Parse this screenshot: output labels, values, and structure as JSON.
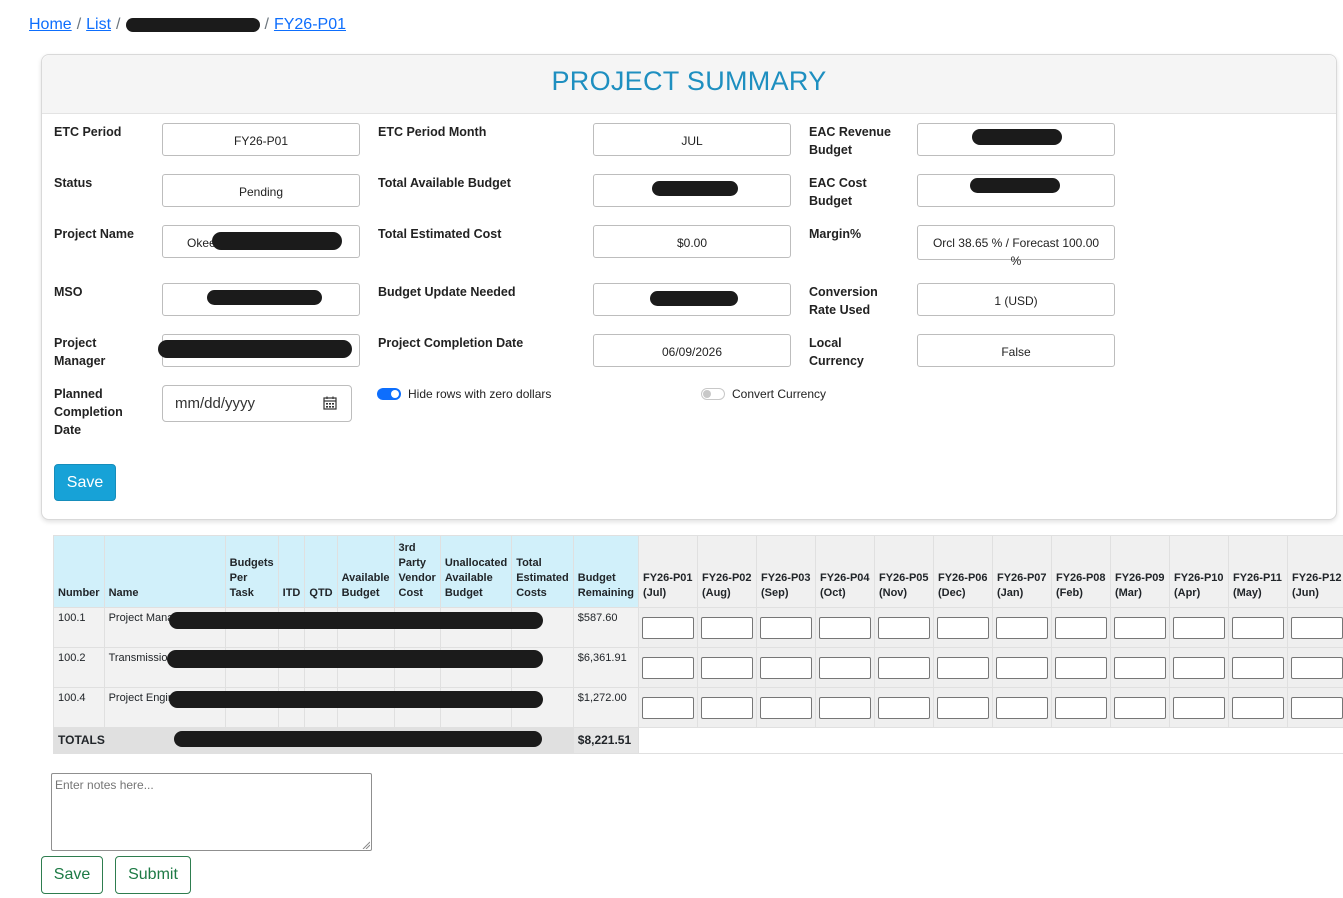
{
  "breadcrumb": {
    "home": "Home",
    "list": "List",
    "current": "FY26-P01",
    "separator": "/"
  },
  "summary": {
    "title": "PROJECT SUMMARY",
    "fields": {
      "etc_period": {
        "label": "ETC Period",
        "value": "FY26-P01"
      },
      "status": {
        "label": "Status",
        "value": "Pending"
      },
      "project_name": {
        "label": "Project Name",
        "value": "Okee"
      },
      "mso": {
        "label": "MSO",
        "value": ""
      },
      "project_manager": {
        "label": "Project Manager",
        "value": ""
      },
      "planned_completion_date": {
        "label": "Planned Completion Date",
        "placeholder": "mm/dd/yyyy"
      },
      "etc_period_month": {
        "label": "ETC Period Month",
        "value": "JUL"
      },
      "total_available_budget": {
        "label": "Total Available Budget",
        "value": ""
      },
      "total_estimated_cost": {
        "label": "Total Estimated Cost",
        "value": "$0.00"
      },
      "budget_update_needed": {
        "label": "Budget Update Needed",
        "value": ""
      },
      "project_completion_date": {
        "label": "Project Completion Date",
        "value": "06/09/2026"
      },
      "eac_revenue_budget": {
        "label": "EAC Revenue Budget",
        "value": ""
      },
      "eac_cost_budget": {
        "label": "EAC Cost Budget",
        "value": ""
      },
      "margin": {
        "label": "Margin%",
        "value": "Orcl 38.65 % / Forecast 100.00 %"
      },
      "conversion_rate_used": {
        "label": "Conversion Rate Used",
        "value": "1 (USD)"
      },
      "local_currency": {
        "label": "Local Currency",
        "value": "False"
      }
    },
    "toggles": {
      "hide_zero_rows": {
        "label": "Hide rows with zero dollars",
        "on": true
      },
      "convert_currency": {
        "label": "Convert Currency",
        "on": false
      }
    },
    "save_label": "Save",
    "accent_color": "#1e8fc0"
  },
  "table": {
    "headers": {
      "number": "Number",
      "name": "Name",
      "budgets_per_task": "Budgets Per Task",
      "itd": "ITD",
      "qtd": "QTD",
      "available_budget": "Available Budget",
      "third_party": "3rd Party Vendor Cost",
      "unallocated": "Unallocated Available Budget",
      "total_estimated": "Total Estimated Costs",
      "budget_remaining": "Budget Remaining"
    },
    "periods": [
      "FY26-P01 (Jul)",
      "FY26-P02 (Aug)",
      "FY26-P03 (Sep)",
      "FY26-P04 (Oct)",
      "FY26-P05 (Nov)",
      "FY26-P06 (Dec)",
      "FY26-P07 (Jan)",
      "FY26-P08 (Feb)",
      "FY26-P09 (Mar)",
      "FY26-P10 (Apr)",
      "FY26-P11 (May)",
      "FY26-P12 (Jun)"
    ],
    "rows": [
      {
        "number": "100.1",
        "name": "Project Manager",
        "budget_remaining": "$587.60"
      },
      {
        "number": "100.2",
        "name": "Transmission Engineer",
        "budget_remaining": "$6,361.91"
      },
      {
        "number": "100.4",
        "name": "Project Engineer",
        "budget_remaining": "$1,272.00"
      }
    ],
    "totals": {
      "label": "TOTALS",
      "budget_remaining": "$8,221.51"
    }
  },
  "notes": {
    "placeholder": "Enter notes here..."
  },
  "actions": {
    "save": "Save",
    "submit": "Submit"
  }
}
